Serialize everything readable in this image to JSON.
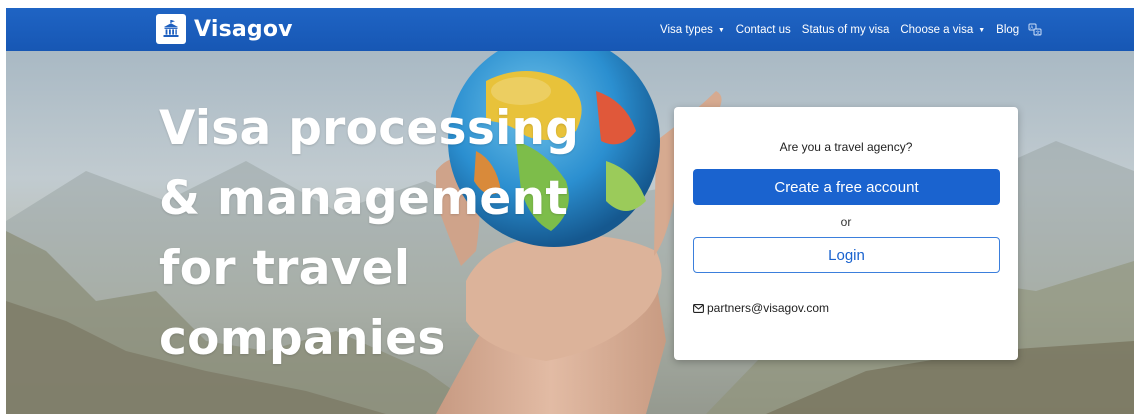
{
  "brand": {
    "name": "Visagov",
    "logo_icon": "government-building-icon"
  },
  "nav": {
    "items": [
      {
        "label": "Visa types",
        "has_dropdown": true
      },
      {
        "label": "Contact us",
        "has_dropdown": false
      },
      {
        "label": "Status of my visa",
        "has_dropdown": false
      },
      {
        "label": "Choose a visa",
        "has_dropdown": true
      },
      {
        "label": "Blog",
        "has_dropdown": false
      }
    ],
    "language_icon": "translate-icon"
  },
  "hero": {
    "title_lines": [
      "Visa processing",
      "& management",
      "for travel",
      "companies"
    ]
  },
  "signup_card": {
    "question": "Are you a travel agency?",
    "create_button_label": "Create a free account",
    "separator": "or",
    "login_button_label": "Login",
    "email": "partners@visagov.com",
    "email_icon": "envelope-icon"
  },
  "colors": {
    "navbar": "#1d5fbf",
    "primary_button": "#1a63cf",
    "outline_border": "#3b7fdc",
    "hero_text": "#ffffff"
  }
}
